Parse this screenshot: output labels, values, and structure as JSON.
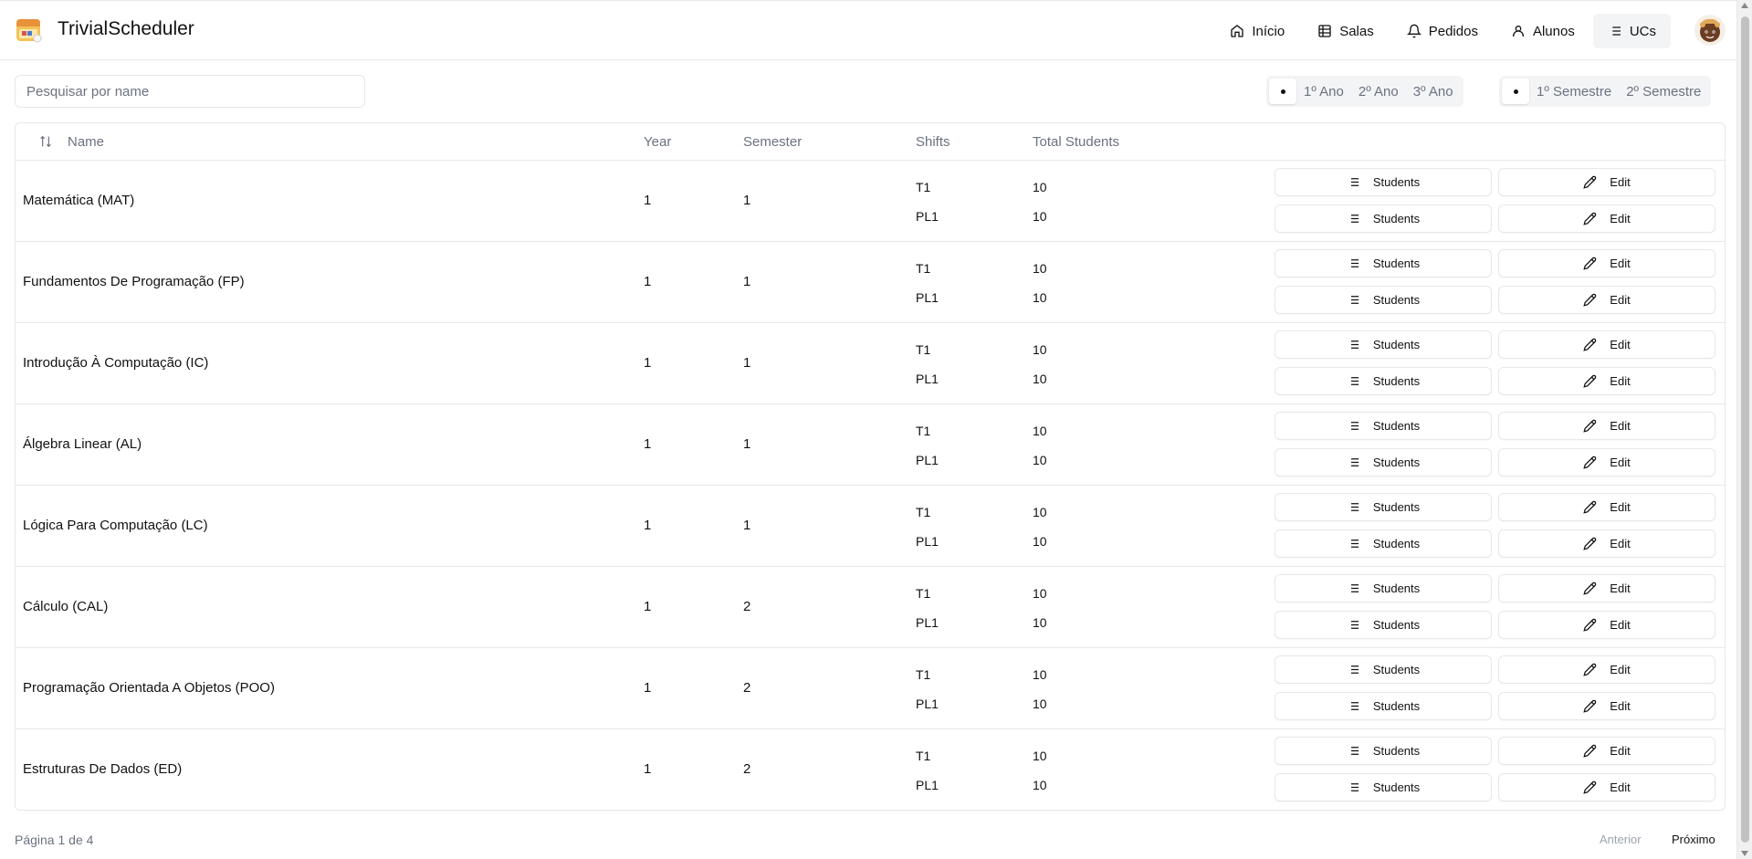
{
  "app": {
    "title": "TrivialScheduler"
  },
  "nav": [
    {
      "label": "Início",
      "icon": "home-icon"
    },
    {
      "label": "Salas",
      "icon": "grid-icon"
    },
    {
      "label": "Pedidos",
      "icon": "bell-icon"
    },
    {
      "label": "Alunos",
      "icon": "user-icon"
    },
    {
      "label": "UCs",
      "icon": "list-icon",
      "active": true
    }
  ],
  "search": {
    "placeholder": "Pesquisar por name",
    "value": ""
  },
  "year_filter": {
    "options": [
      "1º Ano",
      "2º Ano",
      "3º Ano"
    ],
    "selected": "all"
  },
  "semester_filter": {
    "options": [
      "1º Semestre",
      "2º Semestre"
    ],
    "selected": "all"
  },
  "table": {
    "headers": {
      "name": "Name",
      "year": "Year",
      "semester": "Semester",
      "shifts": "Shifts",
      "total": "Total Students"
    },
    "students_label": "Students",
    "edit_label": "Edit",
    "rows": [
      {
        "name": "Matemática (MAT)",
        "year": "1",
        "semester": "1",
        "shifts": [
          {
            "shift": "T1",
            "total": "10"
          },
          {
            "shift": "PL1",
            "total": "10"
          }
        ]
      },
      {
        "name": "Fundamentos De Programação (FP)",
        "year": "1",
        "semester": "1",
        "shifts": [
          {
            "shift": "T1",
            "total": "10"
          },
          {
            "shift": "PL1",
            "total": "10"
          }
        ]
      },
      {
        "name": "Introdução À Computação (IC)",
        "year": "1",
        "semester": "1",
        "shifts": [
          {
            "shift": "T1",
            "total": "10"
          },
          {
            "shift": "PL1",
            "total": "10"
          }
        ]
      },
      {
        "name": "Álgebra Linear (AL)",
        "year": "1",
        "semester": "1",
        "shifts": [
          {
            "shift": "T1",
            "total": "10"
          },
          {
            "shift": "PL1",
            "total": "10"
          }
        ]
      },
      {
        "name": "Lógica Para Computação (LC)",
        "year": "1",
        "semester": "1",
        "shifts": [
          {
            "shift": "T1",
            "total": "10"
          },
          {
            "shift": "PL1",
            "total": "10"
          }
        ]
      },
      {
        "name": "Cálculo (CAL)",
        "year": "1",
        "semester": "2",
        "shifts": [
          {
            "shift": "T1",
            "total": "10"
          },
          {
            "shift": "PL1",
            "total": "10"
          }
        ]
      },
      {
        "name": "Programação Orientada A Objetos (POO)",
        "year": "1",
        "semester": "2",
        "shifts": [
          {
            "shift": "T1",
            "total": "10"
          },
          {
            "shift": "PL1",
            "total": "10"
          }
        ]
      },
      {
        "name": "Estruturas De Dados (ED)",
        "year": "1",
        "semester": "2",
        "shifts": [
          {
            "shift": "T1",
            "total": "10"
          },
          {
            "shift": "PL1",
            "total": "10"
          }
        ]
      }
    ]
  },
  "pagination": {
    "info": "Página 1 de 4",
    "prev": "Anterior",
    "next": "Próximo"
  }
}
